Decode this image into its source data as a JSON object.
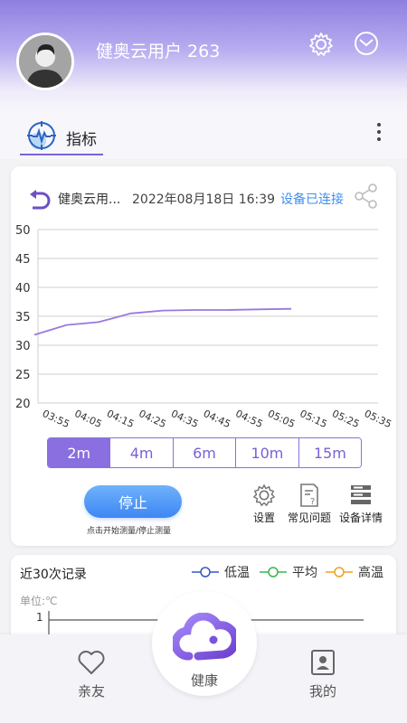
{
  "header": {
    "username": "健奥云用户 263",
    "icons": [
      "avatar",
      "settings-gear-icon",
      "message-icon"
    ]
  },
  "tab": {
    "label": "指标",
    "icon": "heart-monitor-icon"
  },
  "device": {
    "name": "健奥云用...",
    "datetime": "2022年08月18日 16:39",
    "status": "设备已连接"
  },
  "chart_data": {
    "type": "line",
    "x": [
      "03:55",
      "04:05",
      "04:15",
      "04:25",
      "04:35",
      "04:45",
      "04:55",
      "05:05",
      "05:15",
      "05:25",
      "05:35"
    ],
    "series": [
      {
        "values": [
          31.8,
          33.5,
          34.0,
          35.5,
          36.0,
          36.1,
          36.1,
          36.2,
          36.3
        ]
      }
    ],
    "yticks": [
      "50",
      "45",
      "40",
      "35",
      "30",
      "25",
      "20"
    ],
    "ylim": [
      20,
      50
    ],
    "color": "#9a78e0",
    "grid": true
  },
  "segments": {
    "items": [
      "2m",
      "4m",
      "6m",
      "10m",
      "15m"
    ],
    "active": 0
  },
  "actions": {
    "stop": "停止",
    "hint": "点击开始测量/停止测量",
    "settings": "设置",
    "faq": "常见问题",
    "details": "设备详情"
  },
  "records": {
    "title": "近30次记录",
    "legend": [
      {
        "label": "低温",
        "color": "#3557c5"
      },
      {
        "label": "平均",
        "color": "#39b54a"
      },
      {
        "label": "高温",
        "color": "#f0a020"
      }
    ],
    "unit": "单位:℃",
    "first_tick": "1"
  },
  "nav": {
    "friends": "亲友",
    "health": "健康",
    "mine": "我的"
  }
}
